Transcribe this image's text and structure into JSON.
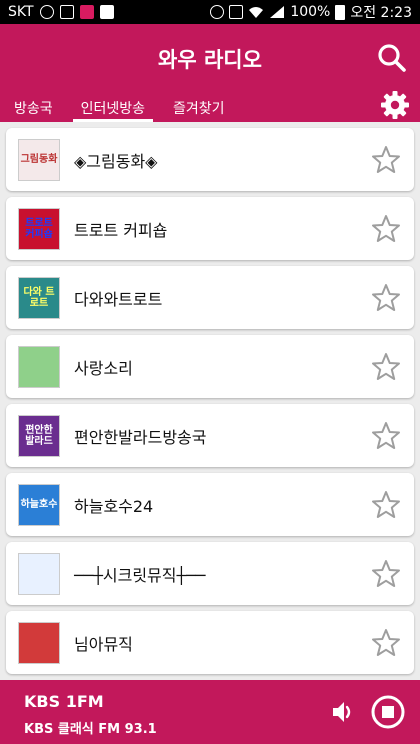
{
  "status_bar": {
    "carrier": "SKT",
    "battery": "100%",
    "time": "오전 2:23"
  },
  "app": {
    "title": "와우 라디오",
    "accent_color": "#c2185b"
  },
  "tabs": [
    {
      "label": "방송국",
      "active": false
    },
    {
      "label": "인터넷방송",
      "active": true
    },
    {
      "label": "즐겨찾기",
      "active": false
    }
  ],
  "stations": [
    {
      "name": "◈그림동화◈",
      "thumb_text": "그림동화",
      "thumb_bg": "#f4e9ea",
      "thumb_fg": "#b33"
    },
    {
      "name": "트로트 커피숍",
      "thumb_text": "트로트 커피숍",
      "thumb_bg": "#c8102e",
      "thumb_fg": "#1a3cff"
    },
    {
      "name": "다와와트로트",
      "thumb_text": "다와 트로트",
      "thumb_bg": "#2a8a8a",
      "thumb_fg": "#ffff66"
    },
    {
      "name": "사랑소리",
      "thumb_text": "",
      "thumb_bg": "#8fd08a",
      "thumb_fg": "#ffffff"
    },
    {
      "name": "편안한발라드방송국",
      "thumb_text": "편안한 발라드",
      "thumb_bg": "#6a2d8f",
      "thumb_fg": "#ffffff"
    },
    {
      "name": "하늘호수24",
      "thumb_text": "하늘호수",
      "thumb_bg": "#2b7fd6",
      "thumb_fg": "#ffffff"
    },
    {
      "name": "──┼시크릿뮤직┼──",
      "thumb_text": "",
      "thumb_bg": "#e8f1ff",
      "thumb_fg": "#3b7dd8"
    },
    {
      "name": "님아뮤직",
      "thumb_text": "",
      "thumb_bg": "#d23a3a",
      "thumb_fg": "#ffffff"
    }
  ],
  "player": {
    "title": "KBS 1FM",
    "subtitle": "KBS 클래식 FM 93.1"
  },
  "icons": {
    "search": "search-icon",
    "settings": "gear-icon",
    "favorite": "star-outline-icon",
    "volume": "volume-icon",
    "stop": "stop-icon"
  }
}
